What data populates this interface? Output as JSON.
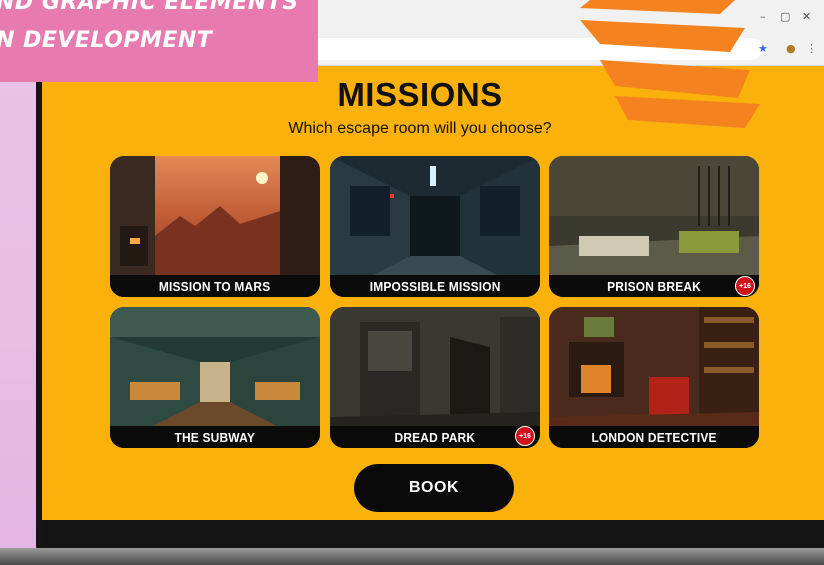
{
  "banner": {
    "line1": "ND GRAPHIC ELEMENTS",
    "line2": "N DEVELOPMENT"
  },
  "browser": {
    "controls": [
      "–",
      "▢",
      "✕"
    ],
    "icons": [
      "star-icon",
      "extension-icon",
      "menu-icon"
    ]
  },
  "page": {
    "title": "MISSIONS",
    "subtitle": "Which escape room will you choose?"
  },
  "missions": [
    {
      "label": "MISSION TO MARS",
      "badge": null
    },
    {
      "label": "IMPOSSIBLE MISSION",
      "badge": null
    },
    {
      "label": "PRISON BREAK",
      "badge": "+16"
    },
    {
      "label": "THE SUBWAY",
      "badge": null
    },
    {
      "label": "DREAD PARK",
      "badge": "+16"
    },
    {
      "label": "LONDON DETECTIVE",
      "badge": null
    }
  ],
  "book_button": {
    "label": "BOOK"
  },
  "colors": {
    "screen_bg": "#fbb10b",
    "button_bg": "#0a0a0a",
    "banner_bg": "#e77bb0",
    "badge_red": "#d1121c"
  }
}
